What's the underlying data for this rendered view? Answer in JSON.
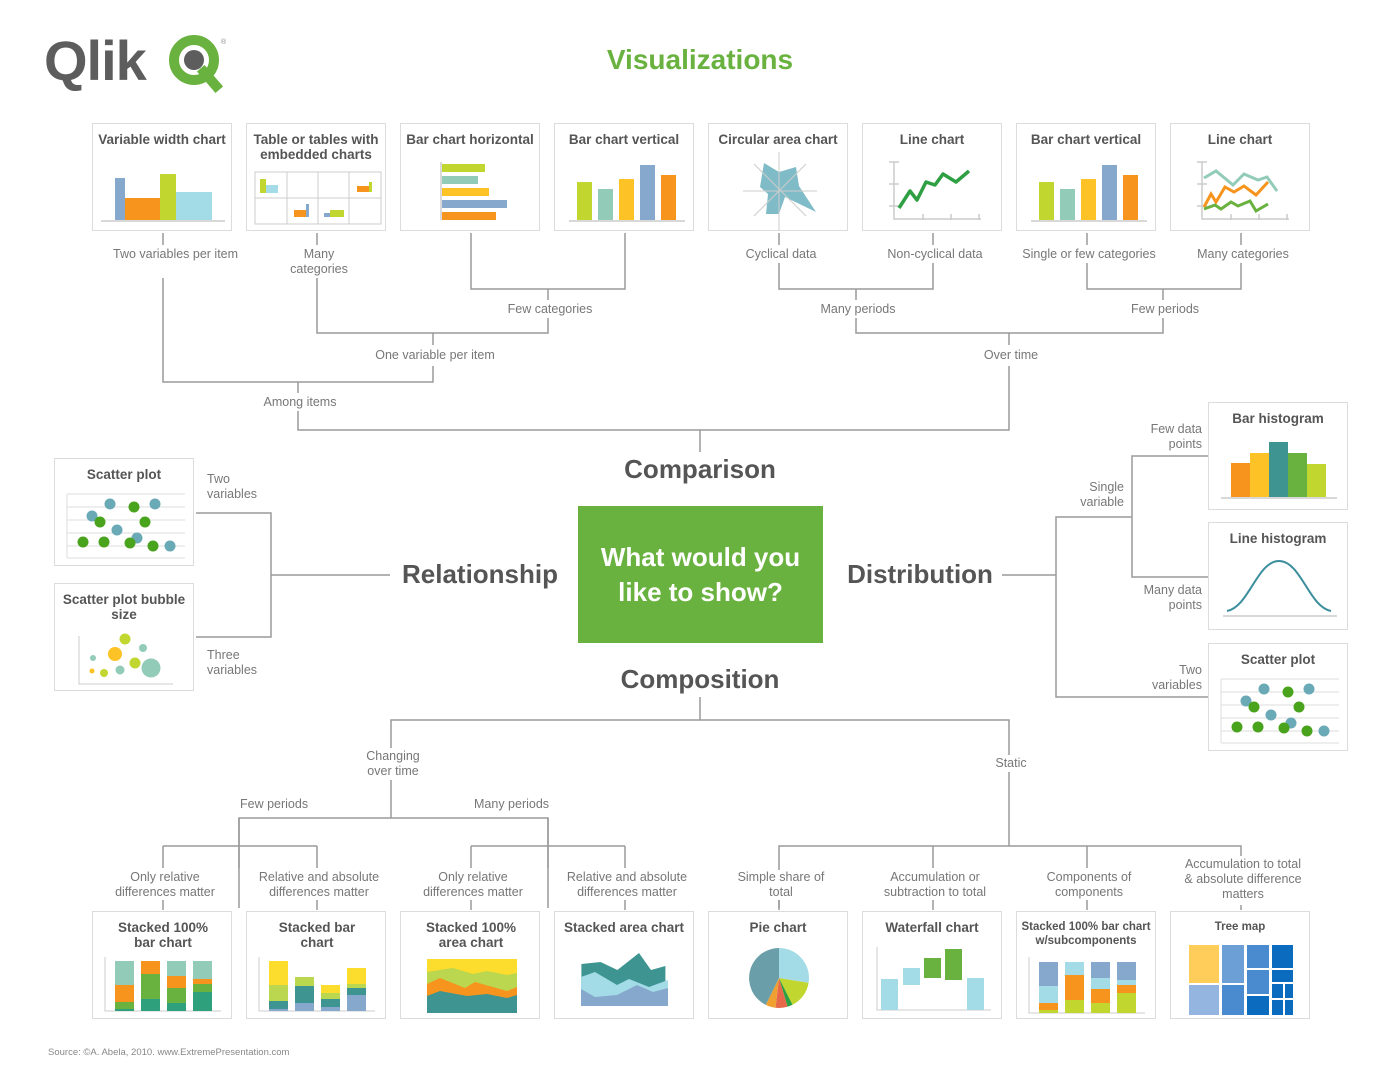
{
  "header": {
    "logo_text": "Qlik",
    "title": "Visualizations",
    "brand_color": "#6ab23f"
  },
  "center": {
    "question": "What would you like to show?",
    "categories": {
      "comparison": "Comparison",
      "relationship": "Relationship",
      "distribution": "Distribution",
      "composition": "Composition"
    }
  },
  "comparison": {
    "cards": [
      {
        "title": "Variable width chart",
        "label": "Two variables per item",
        "icon": "variable-width-chart-icon"
      },
      {
        "title": "Table or tables with embedded charts",
        "label": "Many categories",
        "icon": "embedded-table-icon"
      },
      {
        "title": "Bar chart horizontal",
        "label": "",
        "icon": "horizontal-bar-chart-icon"
      },
      {
        "title": "Bar chart vertical",
        "label": "",
        "icon": "vertical-bar-chart-icon"
      },
      {
        "title": "Circular area chart",
        "label": "Cyclical data",
        "icon": "radar-chart-icon"
      },
      {
        "title": "Line chart",
        "label": "Non-cyclical data",
        "icon": "line-chart-icon"
      },
      {
        "title": "Bar chart vertical",
        "label": "Single or few categories",
        "icon": "vertical-bar-chart-icon"
      },
      {
        "title": "Line chart",
        "label": "Many categories",
        "icon": "multi-line-chart-icon"
      }
    ],
    "branches": {
      "few_categories": "Few categories",
      "one_variable_per_item": "One variable per item",
      "among_items": "Among items",
      "many_periods": "Many periods",
      "few_periods": "Few periods",
      "over_time": "Over time"
    }
  },
  "relationship": {
    "cards": [
      {
        "title": "Scatter plot",
        "label": "Two variables",
        "icon": "scatter-plot-icon"
      },
      {
        "title": "Scatter plot bubble size",
        "label": "Three variables",
        "icon": "bubble-chart-icon"
      }
    ]
  },
  "distribution": {
    "cards": [
      {
        "title": "Bar histogram",
        "label": "Few data points",
        "icon": "bar-histogram-icon"
      },
      {
        "title": "Line histogram",
        "label": "Many data points",
        "icon": "line-histogram-icon"
      },
      {
        "title": "Scatter plot",
        "label": "Two variables",
        "icon": "scatter-plot-icon"
      }
    ],
    "branches": {
      "single_variable": "Single variable"
    }
  },
  "composition": {
    "cards": [
      {
        "title": "Stacked 100% bar chart",
        "label": "Only relative differences matter",
        "icon": "stacked-100-bar-icon"
      },
      {
        "title": "Stacked bar chart",
        "label": "Relative and absolute differences matter",
        "icon": "stacked-bar-icon"
      },
      {
        "title": "Stacked 100% area chart",
        "label": "Only relative differences matter",
        "icon": "stacked-100-area-icon"
      },
      {
        "title": "Stacked area chart",
        "label": "Relative and absolute differences matter",
        "icon": "stacked-area-icon"
      },
      {
        "title": "Pie chart",
        "label": "Simple share of total",
        "icon": "pie-chart-icon"
      },
      {
        "title": "Waterfall chart",
        "label": "Accumulation or subtraction to total",
        "icon": "waterfall-chart-icon"
      },
      {
        "title": "Stacked 100% bar chart w/subcomponents",
        "label": "Components of components",
        "icon": "stacked-subcomponents-icon"
      },
      {
        "title": "Tree map",
        "label": "Accumulation to total & absolute difference matters",
        "icon": "tree-map-icon"
      }
    ],
    "branches": {
      "changing_over_time": "Changing over time",
      "static": "Static",
      "few_periods": "Few periods",
      "many_periods": "Many periods"
    }
  },
  "footer": {
    "source": "Source: ©A. Abela, 2010. www.ExtremePresentation.com"
  }
}
